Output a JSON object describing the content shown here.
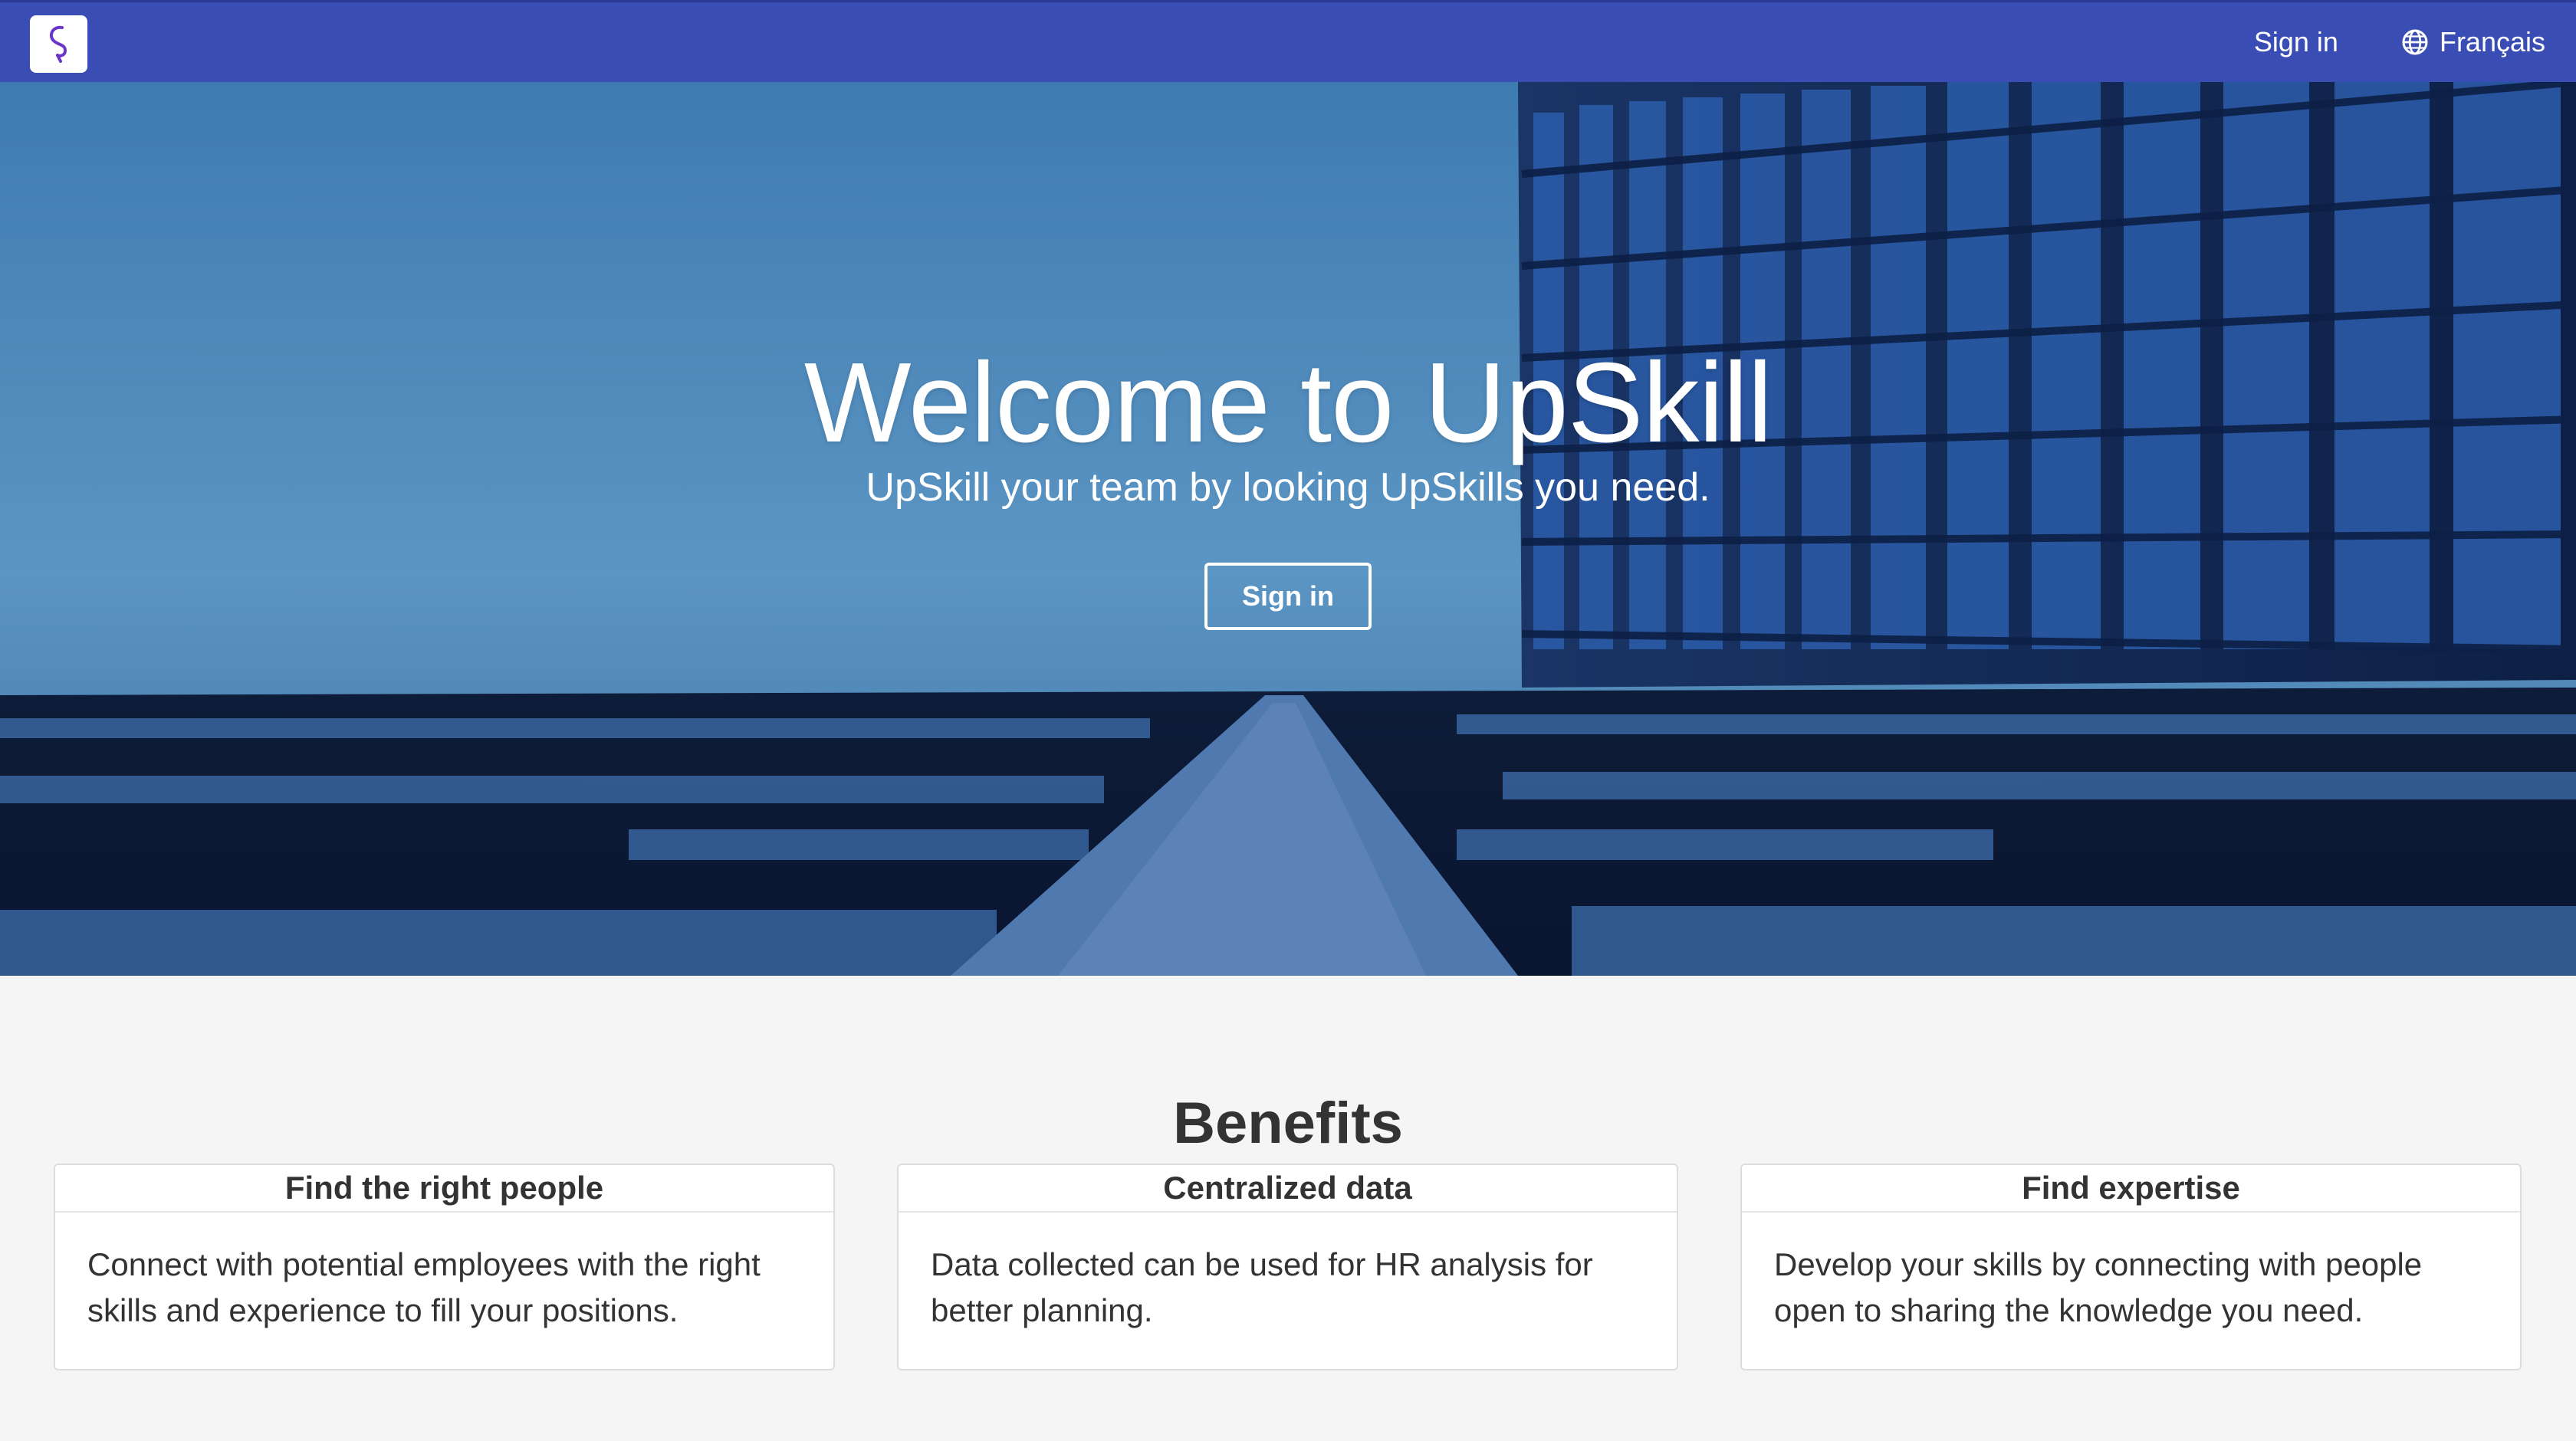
{
  "nav": {
    "logo_icon": "upskill-logo-icon",
    "signin_label": "Sign in",
    "language_icon": "globe-icon",
    "language_label": "Français"
  },
  "hero": {
    "title": "Welcome to UpSkill",
    "subtitle": "UpSkill your team by looking UpSkills you need.",
    "button_label": "Sign in"
  },
  "benefits": {
    "title": "Benefits",
    "cards": [
      {
        "title": "Find the right people",
        "body": "Connect with potential employees with the right skills and experience to fill your positions."
      },
      {
        "title": "Centralized data",
        "body": "Data collected can be used for HR analysis for better planning."
      },
      {
        "title": "Find expertise",
        "body": "Develop your skills by connecting with people open to sharing the knowledge you need."
      }
    ]
  },
  "colors": {
    "nav_bg": "#3a4db4",
    "page_bg": "#f5f5f5",
    "text": "#333333"
  }
}
